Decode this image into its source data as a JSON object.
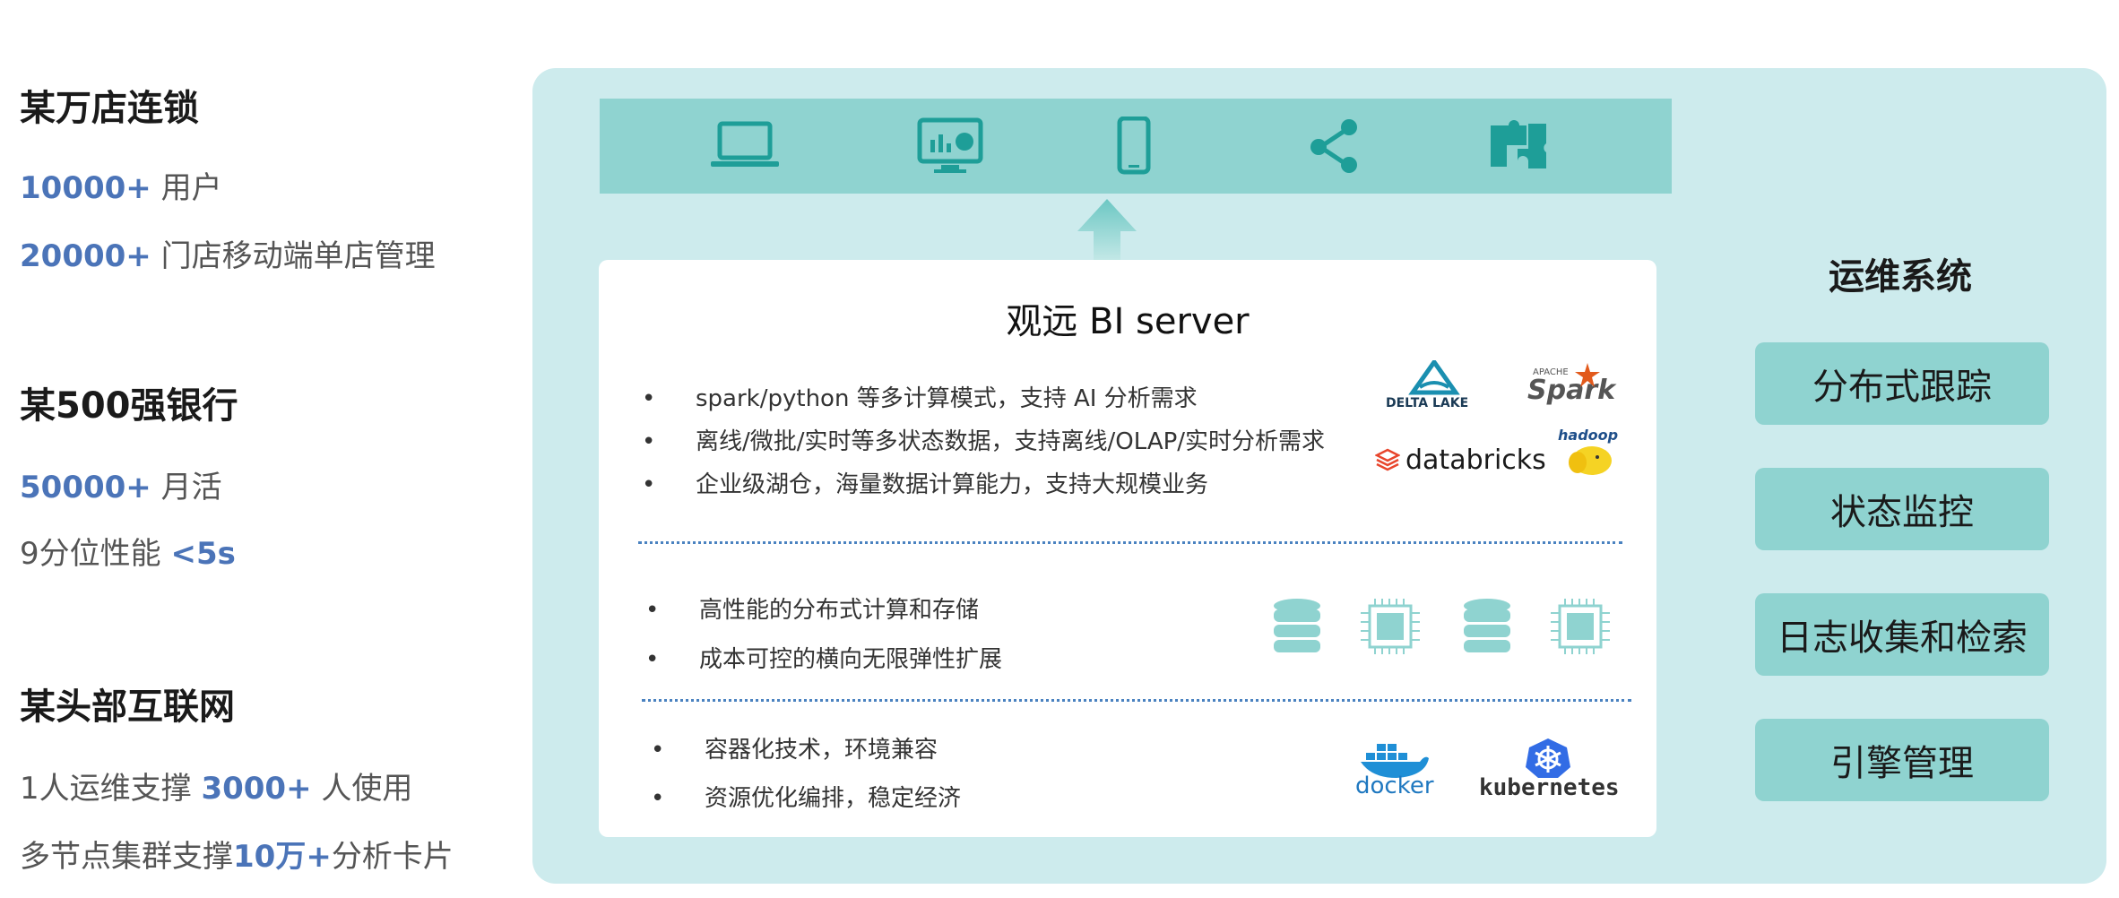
{
  "cases": [
    {
      "title": "某万店连锁",
      "stats": [
        {
          "highlight": "10000+",
          "text": " 用户"
        },
        {
          "highlight": "20000+",
          "text": " 门店移动端单店管理"
        }
      ]
    },
    {
      "title": "某500强银行",
      "stats": [
        {
          "highlight": "50000+",
          "text": " 月活"
        },
        {
          "prefix": "9分位性能 ",
          "highlight": "<5s"
        }
      ]
    },
    {
      "title": "某头部互联网",
      "stats": [
        {
          "prefix": "1人运维支撑 ",
          "highlight": "3000+",
          "text": " 人使用"
        },
        {
          "prefix": "多节点集群支撑",
          "highlight": "10万+",
          "text": "分析卡片"
        }
      ]
    }
  ],
  "icons": [
    "laptop-icon",
    "dashboard-monitor-icon",
    "mobile-phone-icon",
    "share-icon",
    "puzzle-icon"
  ],
  "server": {
    "title": "观远 BI server",
    "section1": [
      "spark/python 等多计算模式，支持 AI 分析需求",
      "离线/微批/实时等多状态数据，支持离线/OLAP/实时分析需求",
      "企业级湖仓，海量数据计算能力，支持大规模业务"
    ],
    "section2": [
      "高性能的分布式计算和存储",
      "成本可控的横向无限弹性扩展"
    ],
    "section3": [
      "容器化技术，环境兼容",
      "资源优化编排，稳定经济"
    ],
    "logos": {
      "delta": "DELTA LAKE",
      "spark": "Spark",
      "spark_small": "APACHE",
      "databricks": "databricks",
      "hadoop": "hadoop",
      "docker": "docker",
      "kubernetes": "kubernetes"
    }
  },
  "ops": {
    "title": "运维系统",
    "buttons": [
      "分布式跟踪",
      "状态监控",
      "日志收集和检索",
      "引擎管理"
    ]
  },
  "colors": {
    "highlight": "#4b74b8",
    "panel": "#cdebed",
    "accent": "#8fd3d0",
    "icon": "#1e9e98"
  }
}
